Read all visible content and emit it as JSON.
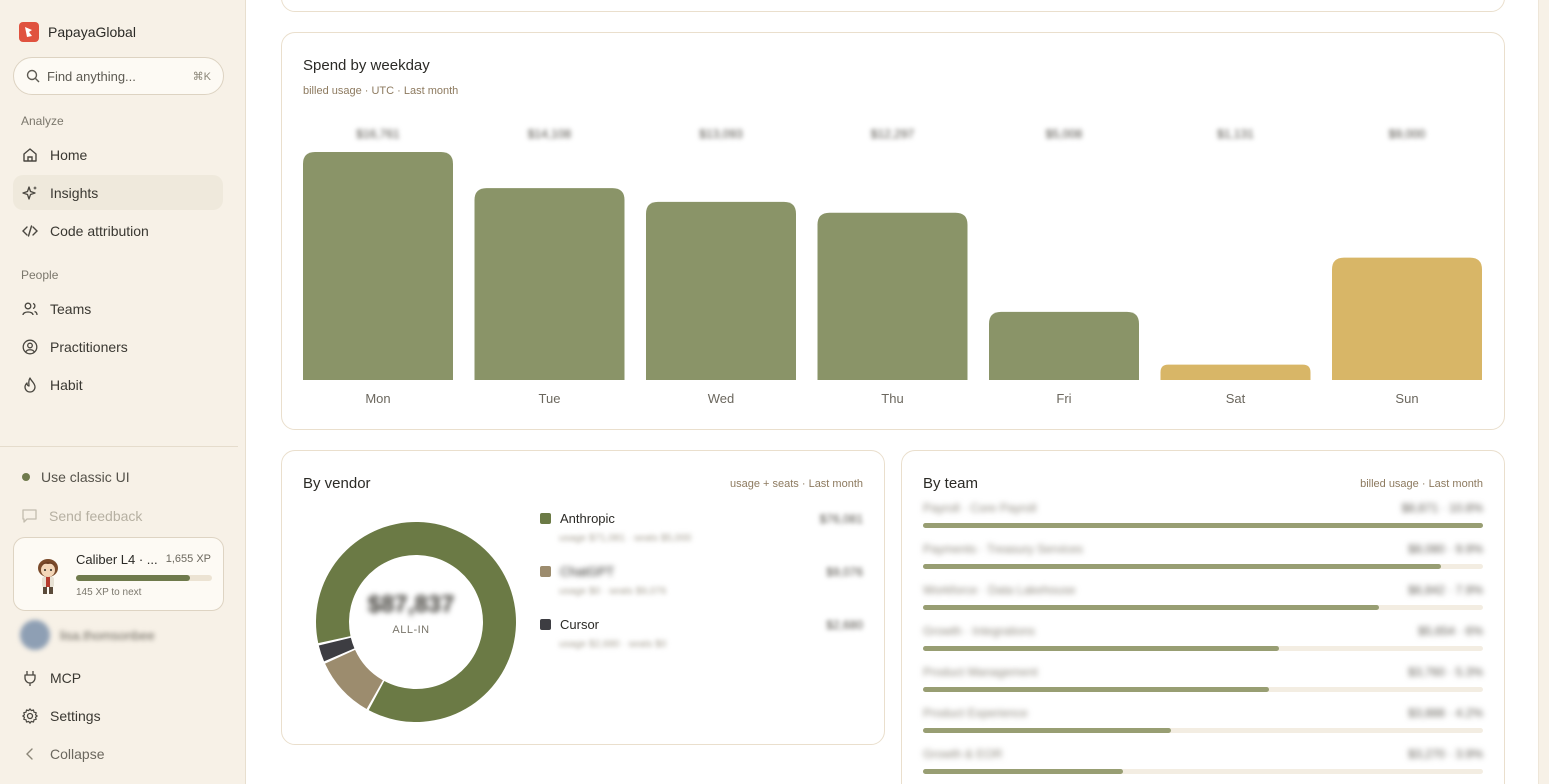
{
  "app": {
    "name": "PapayaGlobal"
  },
  "search": {
    "placeholder": "Find anything...",
    "shortcut": "⌘K"
  },
  "sidebar": {
    "sections": [
      {
        "label": "Analyze"
      },
      {
        "label": "People"
      }
    ],
    "items": [
      {
        "label": "Home",
        "icon": "home-icon"
      },
      {
        "label": "Insights",
        "icon": "sparkles-icon",
        "active": true
      },
      {
        "label": "Code attribution",
        "icon": "code-icon"
      },
      {
        "label": "Teams",
        "icon": "users-icon"
      },
      {
        "label": "Practitioners",
        "icon": "user-circle-icon"
      },
      {
        "label": "Habit",
        "icon": "flame-icon"
      }
    ],
    "classic_ui": "Use classic UI",
    "feedback": "Send feedback",
    "xp": {
      "title": "Caliber L4 · ...",
      "value": "1,655 XP",
      "progress": 0.84,
      "next": "145 XP to next"
    },
    "user": {
      "name": "lisa.thomsonbee"
    },
    "bottom": [
      {
        "label": "MCP",
        "icon": "plug-icon"
      },
      {
        "label": "Settings",
        "icon": "gear-icon"
      },
      {
        "label": "Collapse",
        "icon": "chevron-left-icon"
      }
    ]
  },
  "weekday": {
    "title": "Spend by weekday",
    "subtitle": "billed usage · UTC · Last month",
    "chart_data": {
      "type": "bar",
      "categories": [
        "Mon",
        "Tue",
        "Wed",
        "Thu",
        "Fri",
        "Sat",
        "Sun"
      ],
      "values": [
        16761,
        14108,
        13093,
        12297,
        5008,
        1131,
        9000
      ],
      "value_labels": [
        "$16,761",
        "$14,108",
        "$13,093",
        "$12,297",
        "$5,008",
        "$1,131",
        "$9,000"
      ],
      "weekend": [
        false,
        false,
        false,
        false,
        false,
        true,
        true
      ],
      "colors": {
        "weekday": "#8a9468",
        "weekend": "#d8b667"
      },
      "ylim": [
        0,
        16761
      ]
    }
  },
  "vendor": {
    "title": "By vendor",
    "subtitle": "usage + seats · Last month",
    "total": "$87,837",
    "total_label": "ALL-IN",
    "chart_data": {
      "type": "pie",
      "labels": [
        "Anthropic",
        "ChatGPT",
        "Cursor"
      ],
      "values": [
        76081,
        9076,
        2680
      ],
      "colors": [
        "#6b7a45",
        "#9c8c6e",
        "#3d3d42"
      ]
    },
    "legend": [
      {
        "name": "Anthropic",
        "sub": "usage $71,081 · seats $5,000",
        "value": "$76,081",
        "color": "#6b7a45"
      },
      {
        "name": "ChatGPT",
        "sub": "usage $0 · seats $9,076",
        "value": "$9,076",
        "color": "#9c8c6e"
      },
      {
        "name": "Cursor",
        "sub": "usage $2,680 · seats $0",
        "value": "$2,680",
        "color": "#3d3d42"
      }
    ]
  },
  "team": {
    "title": "By team",
    "subtitle": "billed usage · Last month",
    "rows": [
      {
        "name": "Payroll · Core Payroll",
        "value": "$8,871 · 10.8%",
        "fraction": 1.0
      },
      {
        "name": "Payments · Treasury Services",
        "value": "$8,080 · 9.9%",
        "fraction": 0.925
      },
      {
        "name": "Workforce · Data Lakehouse",
        "value": "$6,842 · 7.9%",
        "fraction": 0.815
      },
      {
        "name": "Growth · Integrations",
        "value": "$5,654 · 6%",
        "fraction": 0.635
      },
      {
        "name": "Product Management",
        "value": "$3,760 · 5.3%",
        "fraction": 0.617
      },
      {
        "name": "Product Experience",
        "value": "$3,888 · 4.2%",
        "fraction": 0.442
      },
      {
        "name": "Growth & EOR",
        "value": "$3,270 · 3.9%",
        "fraction": 0.358
      }
    ]
  }
}
